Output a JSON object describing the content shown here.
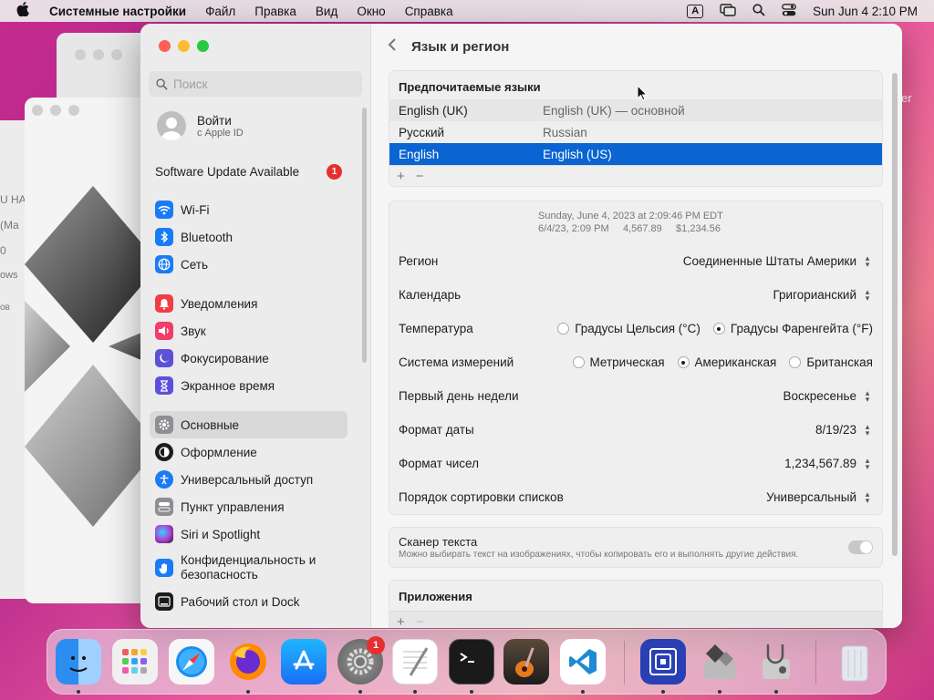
{
  "menubar": {
    "app": "Системные настройки",
    "items": [
      "Файл",
      "Правка",
      "Вид",
      "Окно",
      "Справка"
    ],
    "input_badge": "A",
    "clock": "Sun Jun 4  2:10 PM"
  },
  "background": {
    "left_fragments": [
      "U HA",
      "(Ma",
      "0",
      "ows",
      "ов"
    ],
    "right_fragment": "er"
  },
  "sidebar": {
    "search_placeholder": "Поиск",
    "account_title": "Войти",
    "account_subtitle": "с Apple ID",
    "software_update": "Software Update Available",
    "software_update_badge": "1",
    "group1": [
      {
        "label": "Wi-Fi",
        "icon": "wifi-icon",
        "color": "#1a7cf5"
      },
      {
        "label": "Bluetooth",
        "icon": "bluetooth-icon",
        "color": "#1a7cf5"
      },
      {
        "label": "Сеть",
        "icon": "globe-icon",
        "color": "#1a7cf5"
      }
    ],
    "group2": [
      {
        "label": "Уведомления",
        "icon": "bell-icon",
        "color": "#ef3e45"
      },
      {
        "label": "Звук",
        "icon": "speaker-icon",
        "color": "#ef3e6a"
      },
      {
        "label": "Фокусирование",
        "icon": "moon-icon",
        "color": "#5b51d8"
      },
      {
        "label": "Экранное время",
        "icon": "hourglass-icon",
        "color": "#5b51d8"
      }
    ],
    "group3": [
      {
        "label": "Основные",
        "icon": "gear-icon",
        "color": "#8e8e93",
        "active": true
      },
      {
        "label": "Оформление",
        "icon": "appearance-icon",
        "color": "#1c1c1e"
      },
      {
        "label": "Универсальный доступ",
        "icon": "accessibility-icon",
        "color": "#1a7cf5"
      },
      {
        "label": "Пункт управления",
        "icon": "control-center-icon",
        "color": "#8e8e93"
      },
      {
        "label": "Siri и Spotlight",
        "icon": "siri-icon",
        "color": "#b03ad0"
      },
      {
        "label": "Конфиденциальность и безопасность",
        "icon": "hand-icon",
        "color": "#1a7cf5"
      },
      {
        "label": "Рабочий стол и Dock",
        "icon": "dock-icon",
        "color": "#1c1c1e"
      }
    ]
  },
  "content": {
    "title": "Язык и регион",
    "preferred_title": "Предпочитаемые языки",
    "languages": [
      {
        "name": "English (UK)",
        "detail": "English (UK) — основной"
      },
      {
        "name": "Русский",
        "detail": "Russian"
      },
      {
        "name": "English",
        "detail": "English (US)",
        "selected": true
      }
    ],
    "plus": "+",
    "minus": "−",
    "sample_line1": "Sunday, June 4, 2023 at 2:09:46 PM EDT",
    "sample_line2": "6/4/23, 2:09 PM     4,567.89     $1,234.56",
    "region_label": "Регион",
    "region_value": "Соединенные Штаты Америки",
    "calendar_label": "Календарь",
    "calendar_value": "Григорианский",
    "temp_label": "Температура",
    "temp_options": [
      "Градусы Цельсия (°C)",
      "Градусы Фаренгейта (°F)"
    ],
    "measure_label": "Система измерений",
    "measure_options": [
      "Метрическая",
      "Американская",
      "Британская"
    ],
    "week_label": "Первый день недели",
    "week_value": "Воскресенье",
    "date_label": "Формат даты",
    "date_value": "8/19/23",
    "number_label": "Формат чисел",
    "number_value": "1,234,567.89",
    "sort_label": "Порядок сортировки списков",
    "sort_value": "Универсальный",
    "scanner_title": "Сканер текста",
    "scanner_desc": "Можно выбирать текст на изображениях, чтобы копировать его и выполнять другие действия.",
    "apps_title": "Приложения"
  },
  "dock": {
    "settings_badge": "1",
    "icons": [
      "finder-icon",
      "launchpad-icon",
      "safari-icon",
      "firefox-icon",
      "app-store-icon",
      "system-settings-icon",
      "textedit-icon",
      "terminal-icon",
      "garageband-icon",
      "vscode-icon",
      "utm-icon",
      "bootcamp-icon",
      "disk-utility-icon",
      "trash-icon"
    ]
  }
}
